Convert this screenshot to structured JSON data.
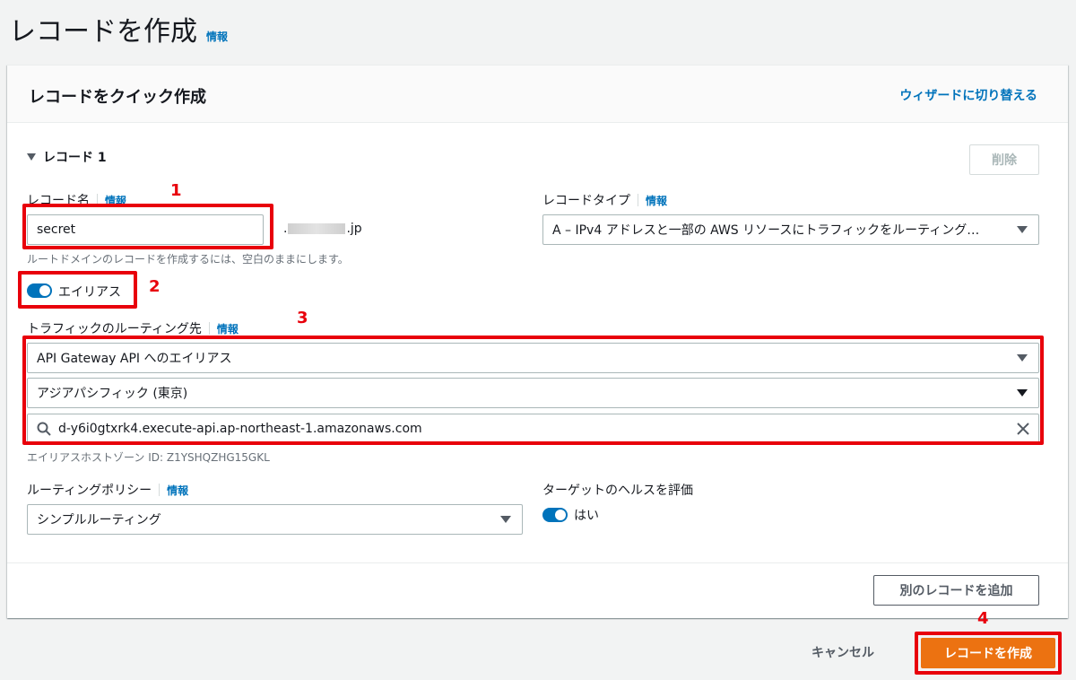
{
  "page": {
    "title": "レコードを作成",
    "info_label": "情報"
  },
  "panel": {
    "title": "レコードをクイック作成",
    "wizard_link": "ウィザードに切り替える"
  },
  "record": {
    "toggle_label": "レコード 1",
    "delete_label": "削除",
    "name_label": "レコード名",
    "name_info": "情報",
    "name_value": "secret",
    "domain_prefix": ".",
    "domain_suffix": ".jp",
    "name_hint": "ルートドメインのレコードを作成するには、空白のままにします。",
    "type_label": "レコードタイプ",
    "type_info": "情報",
    "type_value": "A – IPv4 アドレスと一部の AWS リソースにトラフィックをルーティング…",
    "alias_label": "エイリアス",
    "route_label": "トラフィックのルーティング先",
    "route_info": "情報",
    "route_target": "API Gateway API へのエイリアス",
    "route_region": "アジアパシフィック (東京)",
    "route_endpoint": "d-y6i0gtxrk4.execute-api.ap-northeast-1.amazonaws.com",
    "hosted_zone": "エイリアスホストゾーン ID: Z1YSHQZHG15GKL",
    "policy_label": "ルーティングポリシー",
    "policy_info": "情報",
    "policy_value": "シンプルルーティング",
    "health_label": "ターゲットのヘルスを評価",
    "health_value": "はい"
  },
  "actions": {
    "add_record": "別のレコードを追加",
    "cancel": "キャンセル",
    "create": "レコードを作成"
  },
  "annotations": {
    "m1": "1",
    "m2": "2",
    "m3": "3",
    "m4": "4"
  },
  "colors": {
    "accent": "#0073bb",
    "primary_button": "#ec7211",
    "annotation_red": "#e8000b"
  },
  "icons": {
    "search": "search-icon",
    "clear": "close-icon",
    "caret": "caret-down-icon"
  }
}
